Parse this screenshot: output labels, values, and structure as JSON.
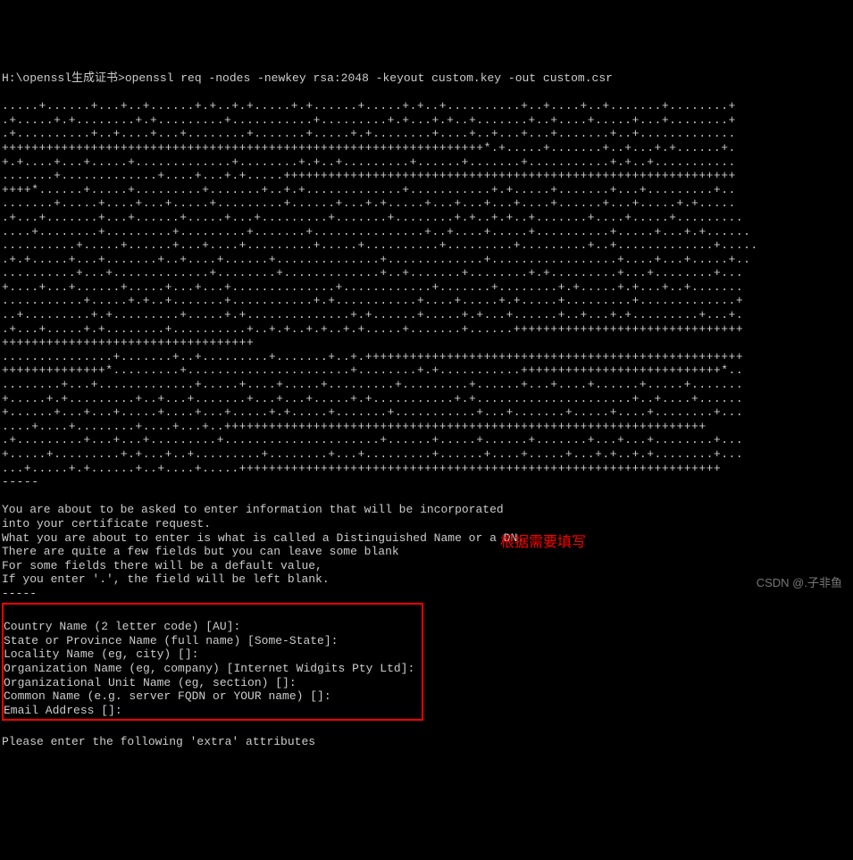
{
  "prompt": {
    "path": "H:\\openssl生成证书>",
    "command": "openssl req -nodes -newkey rsa:2048 -keyout custom.key -out custom.csr"
  },
  "keygen_lines": [
    ".....+......+...+..+......+.+..+.+.....+.+......+.....+.+..+..........+..+....+..+.......+........+",
    ".+.....+.+........+.+.........+...........+.........+.+...+.+..+.......+..+....+.....+...+........+",
    ".+..........+..+....+...+........+.......+.....+.+........+....+..+...+...+.......+..+.............",
    "+++++++++++++++++++++++++++++++++++++++++++++++++++++++++++++++++*.+.....+.......+..+...+.+......+.",
    "+.+....+...+.....+.............+........+.+..+.........+......+.......+...........+.+..+...........",
    ".......+.............+....+...+.+.....+++++++++++++++++++++++++++++++++++++++++++++++++++++++++++++",
    "++++*......+.....+.........+.......+..+.+.............+...........+.+.....+.......+...+.........+..",
    ".......+.....+....+...+.....+.........+......+...+.+.....+...+...+...+....+......+...+.....+.+.....",
    ".+...+.......+...+......+.....+...+.........+.......+........+.+..+.+..+.......+....+.....+.........",
    "....+........+.........+.........+.......+...............+..+....+.....+..........+.....+...+.+......",
    "..........+.....+......+...+....+.........+.....+..........+.........+.........+..+.............+.....",
    ".+.+.....+...+.......+..+....+......+..............+.............+.................+....+...+.....+..",
    "..........+...+.............+........+.............+..+.......+........+.+.........+...+........+...",
    "+....+...+......+.....+...+...+..............+............+.......+........+.+.....+.+...+..+.......",
    "...........+.....+.+..+.......+...........+.+...........+....+.....+.+.....+.........+.............+",
    "..+.........+.+.........+.....+.+..............+.+......+.....+.+...+......+..+...+.+.........+...+.",
    ".+...+.....+.+........+..........+..+.+..+.+..+.+.....+.......+......+++++++++++++++++++++++++++++++",
    "++++++++++++++++++++++++++++++++++",
    "...............+.......+..+.........+.......+..+.+++++++++++++++++++++++++++++++++++++++++++++++++++",
    "++++++++++++++*.........+......................+........+.+...........+++++++++++++++++++++++++++*..",
    "........+...+.............+.....+....+.....+.........+.........+......+...+....+......+.....+.......",
    "+.....+.+.........+..+...+.......+...+...+.....+.+...........+.+.....................+..+....+......",
    "+......+...+...+.....+....+...+.....+.+.....+.......+...........+...+.......+.....+....+........+...",
    "....+....+........+....+...+..+++++++++++++++++++++++++++++++++++++++++++++++++++++++++++++++++",
    ".+.........+...+...+.........+.....................+......+.....+......+.......+...+...+........+...",
    "+.....+.........+.+...+..+.........+........+...+.........+......+....+.....+...+.+..+.+........+...",
    "...+.....+.+......+..+....+.....+++++++++++++++++++++++++++++++++++++++++++++++++++++++++++++++++",
    "-----"
  ],
  "info_lines": [
    "You are about to be asked to enter information that will be incorporated",
    "into your certificate request.",
    "What you are about to enter is what is called a Distinguished Name or a DN.",
    "There are quite a few fields but you can leave some blank",
    "For some fields there will be a default value,",
    "If you enter '.', the field will be left blank.",
    "-----"
  ],
  "dn_fields": [
    "Country Name (2 letter code) [AU]:",
    "State or Province Name (full name) [Some-State]:",
    "Locality Name (eg, city) []:",
    "Organization Name (eg, company) [Internet Widgits Pty Ltd]:",
    "Organizational Unit Name (eg, section) []:",
    "Common Name (e.g. server FQDN or YOUR name) []:",
    "Email Address []:"
  ],
  "extra_prompt": "Please enter the following 'extra' attributes",
  "annotation": "根据需要填写",
  "watermark": "CSDN @.子非鱼"
}
